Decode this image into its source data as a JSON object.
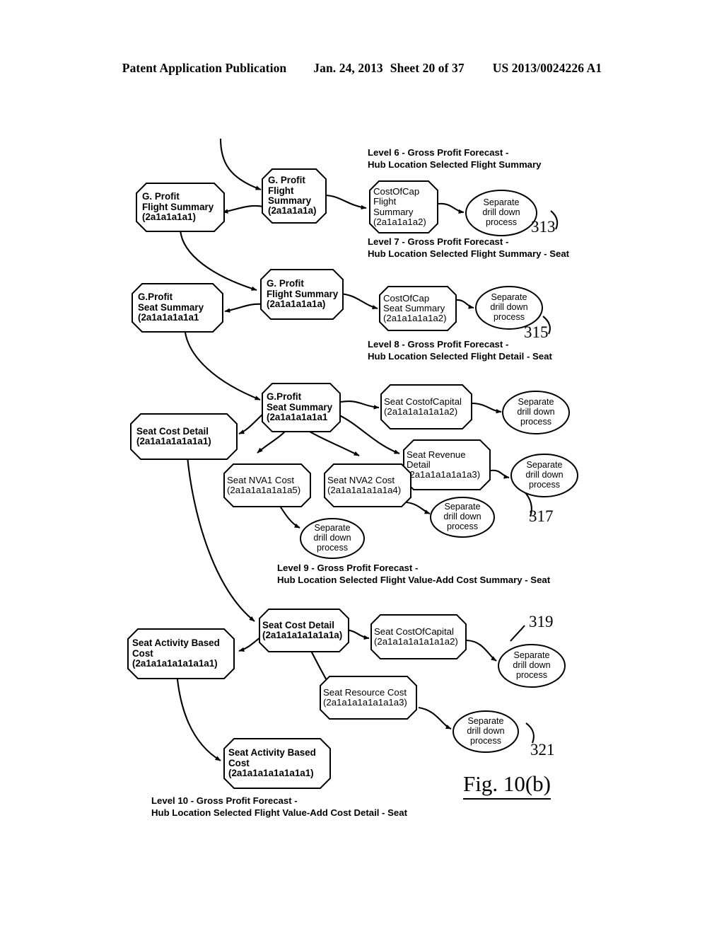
{
  "header": {
    "left": "Patent Application Publication",
    "date": "Jan. 24, 2013",
    "sheet": "Sheet 20 of 37",
    "pubnum": "US 2013/0024226 A1"
  },
  "figure": {
    "label": "Fig. 10(b)"
  },
  "separate_process_text": {
    "l1": "Separate",
    "l2": "drill down",
    "l3": "process"
  },
  "captions": [
    {
      "id": "level6",
      "l1": "Level 6 - Gross Profit Forecast -",
      "l2": "Hub Location Selected Flight Summary"
    },
    {
      "id": "level7",
      "l1": "Level 7 - Gross Profit Forecast -",
      "l2": "Hub Location Selected Flight Summary - Seat"
    },
    {
      "id": "level8",
      "l1": "Level 8 - Gross Profit Forecast -",
      "l2": "Hub Location Selected Flight Detail - Seat"
    },
    {
      "id": "level9",
      "l1": "Level 9 - Gross Profit Forecast -",
      "l2": "Hub Location Selected Flight Value-Add Cost Summary - Seat"
    },
    {
      "id": "level10",
      "l1": "Level 10 - Gross Profit Forecast -",
      "l2": "Hub Location Selected Flight Value-Add Cost Detail - Seat"
    }
  ],
  "refnums": [
    {
      "id": "313",
      "value": "313"
    },
    {
      "id": "315",
      "value": "315"
    },
    {
      "id": "317",
      "value": "317"
    },
    {
      "id": "319",
      "value": "319"
    },
    {
      "id": "321",
      "value": "321"
    }
  ],
  "nodes": {
    "gp_flight_summary_left": {
      "l1": "G. Profit",
      "l2": "Flight Summary",
      "l3": "(2a1a1a1a1)"
    },
    "gp_flight_summary_center": {
      "l1": "G. Profit",
      "l2": "Flight",
      "l3": "Summary",
      "l4": "(2a1a1a1a)"
    },
    "costofcap_flight_summary": {
      "l1": "CostOfCap",
      "l2": "Flight",
      "l3": "Summary",
      "l4": "(2a1a1a1a2)"
    },
    "gp_seat_summary_left": {
      "l1": "G.Profit",
      "l2": "Seat  Summary",
      "l3": "(2a1a1a1a1a1"
    },
    "gp_flight_summary_center2": {
      "l1": "G. Profit",
      "l2": "Flight Summary",
      "l3": "(2a1a1a1a1a)"
    },
    "costofcap_seat_summary": {
      "l1": "CostOfCap",
      "l2": "Seat  Summary",
      "l3": "(2a1a1a1a1a2)"
    },
    "gp_seat_summary_center": {
      "l1": "G.Profit",
      "l2": "Seat  Summary",
      "l3": "(2a1a1a1a1a1"
    },
    "seat_cost_detail_left": {
      "l1": "Seat Cost Detail",
      "l2": "(2a1a1a1a1a1a1)"
    },
    "seat_costofcapital_mid": {
      "l1": "Seat CostofCapital",
      "l2": "(2a1a1a1a1a1a2)"
    },
    "seat_revenue_detail": {
      "l1": "Seat Revenue",
      "l2": "Detail",
      "l3": "(2a1a1a1a1a1a3)"
    },
    "seat_nva1_cost": {
      "l1": "Seat NVA1 Cost",
      "l2": "(2a1a1a1a1a1a5)"
    },
    "seat_nva2_cost": {
      "l1": "Seat NVA2 Cost",
      "l2": "(2a1a1a1a1a1a4)"
    },
    "seat_cost_detail_center": {
      "l1": "Seat Cost Detail",
      "l2": "(2a1a1a1a1a1a1a)"
    },
    "seat_activity_based_cost_left": {
      "l1": "Seat Activity Based",
      "l2": "Cost",
      "l3": "(2a1a1a1a1a1a1a1)"
    },
    "seat_costofcapital_bottom": {
      "l1": "Seat CostOfCapital",
      "l2": "(2a1a1a1a1a1a1a2)"
    },
    "seat_resource_cost": {
      "l1": "Seat Resource Cost",
      "l2": "(2a1a1a1a1a1a1a3)"
    },
    "seat_activity_based_cost_bottom": {
      "l1": "Seat Activity Based",
      "l2": "Cost",
      "l3": "(2a1a1a1a1a1a1a1)"
    }
  }
}
